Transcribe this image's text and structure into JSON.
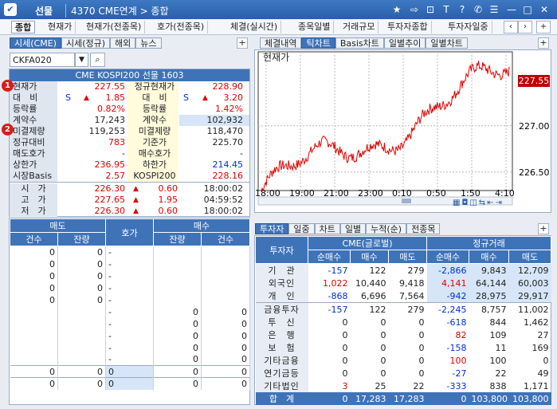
{
  "window": {
    "app_label": "선물",
    "screen_title": "4370 CME연계 > 종합"
  },
  "menu": {
    "tabs": [
      "종합",
      "현재가",
      "현재가(전종목)",
      "호가(전종목)",
      "체결(실시간)",
      "종목일별",
      "거래규모",
      "투자자종합",
      "투자자일중"
    ]
  },
  "left_tabs": [
    "시세(CME)",
    "시세(정규)",
    "해외",
    "뉴스"
  ],
  "code_input": "CKFA020",
  "quote": {
    "header": "CME KOSPI200 선물 1603",
    "badges": [
      "1",
      "2"
    ],
    "rows": [
      {
        "l": "현재가",
        "l_val": "227.55",
        "r": "정규현재가",
        "r_val": "228.90"
      },
      {
        "l": "대　비",
        "l_mark": "S",
        "l_tri": "▲",
        "l_val": "1.85",
        "r": "대　비",
        "r_mark": "S",
        "r_tri": "▲",
        "r_val": "3.20"
      },
      {
        "l": "등락률",
        "l_val": "0.82%",
        "r": "등락률",
        "r_val": "1.42%"
      },
      {
        "l": "계약수",
        "l_val": "17,243",
        "r": "계약수",
        "r_val": "102,932"
      },
      {
        "l": "미결제량",
        "l_val": "119,253",
        "r": "미결제량",
        "r_val": "118,470"
      },
      {
        "l": "정규대비",
        "l_val": "783",
        "r": "기준가",
        "r_val": "225.70"
      },
      {
        "l": "매도호가",
        "l_val": "-",
        "r": "매수호가",
        "r_val": "-"
      },
      {
        "l": "상한가",
        "l_val": "236.95",
        "r": "하한가",
        "r_val": "214.45"
      },
      {
        "l": "시장Basis",
        "l_val": "2.57",
        "r": "KOSPI200",
        "r_val": "228.16"
      }
    ],
    "ohlc": [
      {
        "l": "시　가",
        "v": "226.30",
        "d": "0.60",
        "t": "18:00:02"
      },
      {
        "l": "고　가",
        "v": "227.65",
        "d": "1.95",
        "t": "04:59:52"
      },
      {
        "l": "저　가",
        "v": "226.30",
        "d": "0.60",
        "t": "18:00:02"
      }
    ]
  },
  "orderbook": {
    "head_sell": "매도",
    "head_price": "호가",
    "head_buy": "매수",
    "sub": [
      "건수",
      "잔량",
      "잔량",
      "건수"
    ],
    "rows": [
      [
        "0",
        "0",
        "-",
        "",
        ""
      ],
      [
        "0",
        "0",
        "-",
        "",
        ""
      ],
      [
        "0",
        "0",
        "-",
        "",
        ""
      ],
      [
        "0",
        "0",
        "-",
        "",
        ""
      ],
      [
        "0",
        "0",
        "-",
        "",
        ""
      ],
      [
        "",
        "",
        "-",
        "0",
        "0"
      ],
      [
        "",
        "",
        "-",
        "0",
        "0"
      ],
      [
        "",
        "",
        "-",
        "0",
        "0"
      ],
      [
        "",
        "",
        "-",
        "0",
        "0"
      ],
      [
        "",
        "",
        "-",
        "0",
        "0"
      ]
    ],
    "totals": [
      [
        "0",
        "0",
        "0",
        "0",
        "0"
      ],
      [
        "0",
        "0",
        "0",
        "0",
        "0"
      ]
    ]
  },
  "chart_tabs": [
    "체결내역",
    "틱차트",
    "Basis차트",
    "일별추이",
    "일별차트"
  ],
  "chart_data": {
    "type": "line",
    "title": "현재가",
    "ylim": [
      226.3,
      227.8
    ],
    "yticks": [
      "227.00",
      "226.50"
    ],
    "current_label": "227.55",
    "xticks": [
      "18:00",
      "19:00",
      "21:00",
      "23:00",
      "0:10",
      "0:50",
      "1:50",
      "4:10"
    ]
  },
  "investor_tabs": [
    "투자자",
    "일중",
    "차트",
    "일별",
    "누적(순)",
    "전종목"
  ],
  "investor": {
    "col_investor": "투자자",
    "group_cme": "CME(글로벌)",
    "group_reg": "정규거래",
    "sub": [
      "순매수",
      "매수",
      "매도",
      "순매수",
      "매수",
      "매도"
    ],
    "rows": [
      {
        "name": "기　관",
        "v": [
          "-157",
          "122",
          "279",
          "-2,866",
          "9,843",
          "12,709"
        ]
      },
      {
        "name": "외국인",
        "v": [
          "1,022",
          "10,440",
          "9,418",
          "4,141",
          "64,144",
          "60,003"
        ]
      },
      {
        "name": "개　인",
        "v": [
          "-868",
          "6,696",
          "7,564",
          "-942",
          "28,975",
          "29,917"
        ]
      },
      {
        "name": "금융투자",
        "v": [
          "-157",
          "122",
          "279",
          "-2,245",
          "8,757",
          "11,002"
        ]
      },
      {
        "name": "투　신",
        "v": [
          "0",
          "0",
          "0",
          "-618",
          "844",
          "1,462"
        ]
      },
      {
        "name": "은　행",
        "v": [
          "0",
          "0",
          "0",
          "82",
          "109",
          "27"
        ]
      },
      {
        "name": "보　험",
        "v": [
          "0",
          "0",
          "0",
          "-158",
          "11",
          "169"
        ]
      },
      {
        "name": "기타금융",
        "v": [
          "0",
          "0",
          "0",
          "100",
          "100",
          "0"
        ]
      },
      {
        "name": "연기금등",
        "v": [
          "0",
          "0",
          "0",
          "-27",
          "22",
          "49"
        ]
      },
      {
        "name": "기타법인",
        "v": [
          "3",
          "25",
          "22",
          "-333",
          "838",
          "1,171"
        ]
      }
    ],
    "total": {
      "name": "합　계",
      "v": [
        "0",
        "17,283",
        "17,283",
        "0",
        "103,800",
        "103,800"
      ]
    }
  },
  "colors": {
    "accent": "#3f73b8",
    "up": "#e00000",
    "down": "#0030d0"
  }
}
